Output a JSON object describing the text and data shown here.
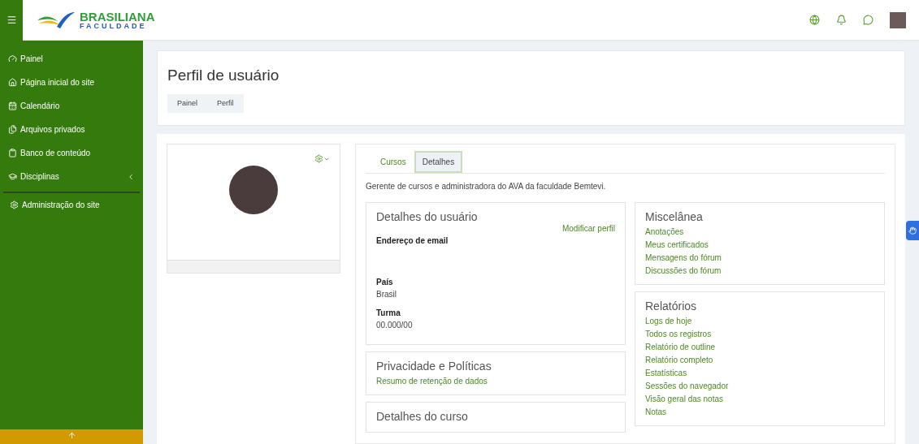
{
  "logo": {
    "name": "BRASILIANA",
    "subtitle": "FACULDADE"
  },
  "sidebar": {
    "items": [
      {
        "kind": "dashboard",
        "label": "Painel"
      },
      {
        "kind": "home",
        "label": "Página inicial do site"
      },
      {
        "kind": "calendar",
        "label": "Calendário"
      },
      {
        "kind": "files",
        "label": "Arquivos privados"
      },
      {
        "kind": "content",
        "label": "Banco de conteúdo"
      },
      {
        "kind": "courses",
        "label": "Disciplinas",
        "expanded": false
      },
      {
        "kind": "admin",
        "label": "Administração do site"
      }
    ]
  },
  "header": {
    "title": "Perfil de usuário",
    "breadcrumb": [
      "Painel",
      "Perfil"
    ]
  },
  "tabs": [
    {
      "label": "Cursos",
      "selected": false
    },
    {
      "label": "Detalhes",
      "selected": true
    }
  ],
  "description": "Gerente de cursos e administradora do AVA da faculdade Bemtevi.",
  "left_sections": [
    {
      "title": "Detalhes do usuário",
      "action": "Modificar perfil",
      "fields": [
        {
          "label": "Endereço de email"
        },
        {
          "label": "País",
          "value": "Brasil"
        },
        {
          "label": "Turma",
          "value": "00.000/00"
        }
      ]
    },
    {
      "title": "Privacidade e Políticas",
      "links": [
        "Resumo de retenção de dados"
      ]
    },
    {
      "title": "Detalhes do curso"
    }
  ],
  "right_sections": [
    {
      "title": "Miscelânea",
      "links": [
        "Anotações",
        "Meus certificados",
        "Mensagens do fórum",
        "Discussões do fórum"
      ]
    },
    {
      "title": "Relatórios",
      "links": [
        "Logs de hoje",
        "Todos os registros",
        "Relatório de outline",
        "Relatório completo",
        "Estatísticas",
        "Sessões do navegador",
        "Visão geral das notas",
        "Notas"
      ]
    }
  ]
}
